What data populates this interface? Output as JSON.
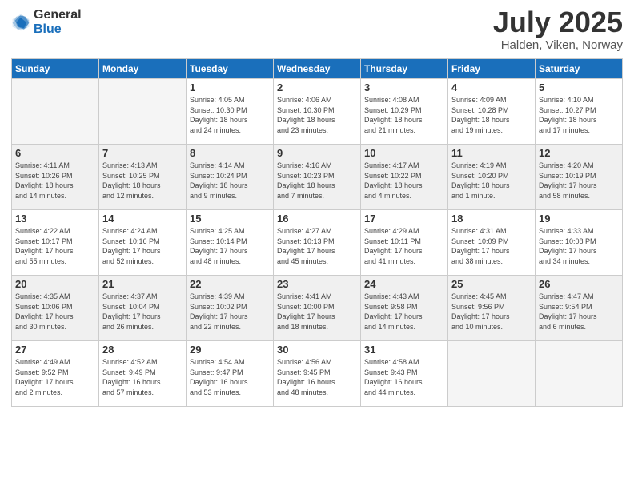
{
  "logo": {
    "general": "General",
    "blue": "Blue"
  },
  "title": {
    "month_year": "July 2025",
    "location": "Halden, Viken, Norway"
  },
  "weekdays": [
    "Sunday",
    "Monday",
    "Tuesday",
    "Wednesday",
    "Thursday",
    "Friday",
    "Saturday"
  ],
  "weeks": [
    [
      {
        "day": "",
        "info": ""
      },
      {
        "day": "",
        "info": ""
      },
      {
        "day": "1",
        "info": "Sunrise: 4:05 AM\nSunset: 10:30 PM\nDaylight: 18 hours\nand 24 minutes."
      },
      {
        "day": "2",
        "info": "Sunrise: 4:06 AM\nSunset: 10:30 PM\nDaylight: 18 hours\nand 23 minutes."
      },
      {
        "day": "3",
        "info": "Sunrise: 4:08 AM\nSunset: 10:29 PM\nDaylight: 18 hours\nand 21 minutes."
      },
      {
        "day": "4",
        "info": "Sunrise: 4:09 AM\nSunset: 10:28 PM\nDaylight: 18 hours\nand 19 minutes."
      },
      {
        "day": "5",
        "info": "Sunrise: 4:10 AM\nSunset: 10:27 PM\nDaylight: 18 hours\nand 17 minutes."
      }
    ],
    [
      {
        "day": "6",
        "info": "Sunrise: 4:11 AM\nSunset: 10:26 PM\nDaylight: 18 hours\nand 14 minutes."
      },
      {
        "day": "7",
        "info": "Sunrise: 4:13 AM\nSunset: 10:25 PM\nDaylight: 18 hours\nand 12 minutes."
      },
      {
        "day": "8",
        "info": "Sunrise: 4:14 AM\nSunset: 10:24 PM\nDaylight: 18 hours\nand 9 minutes."
      },
      {
        "day": "9",
        "info": "Sunrise: 4:16 AM\nSunset: 10:23 PM\nDaylight: 18 hours\nand 7 minutes."
      },
      {
        "day": "10",
        "info": "Sunrise: 4:17 AM\nSunset: 10:22 PM\nDaylight: 18 hours\nand 4 minutes."
      },
      {
        "day": "11",
        "info": "Sunrise: 4:19 AM\nSunset: 10:20 PM\nDaylight: 18 hours\nand 1 minute."
      },
      {
        "day": "12",
        "info": "Sunrise: 4:20 AM\nSunset: 10:19 PM\nDaylight: 17 hours\nand 58 minutes."
      }
    ],
    [
      {
        "day": "13",
        "info": "Sunrise: 4:22 AM\nSunset: 10:17 PM\nDaylight: 17 hours\nand 55 minutes."
      },
      {
        "day": "14",
        "info": "Sunrise: 4:24 AM\nSunset: 10:16 PM\nDaylight: 17 hours\nand 52 minutes."
      },
      {
        "day": "15",
        "info": "Sunrise: 4:25 AM\nSunset: 10:14 PM\nDaylight: 17 hours\nand 48 minutes."
      },
      {
        "day": "16",
        "info": "Sunrise: 4:27 AM\nSunset: 10:13 PM\nDaylight: 17 hours\nand 45 minutes."
      },
      {
        "day": "17",
        "info": "Sunrise: 4:29 AM\nSunset: 10:11 PM\nDaylight: 17 hours\nand 41 minutes."
      },
      {
        "day": "18",
        "info": "Sunrise: 4:31 AM\nSunset: 10:09 PM\nDaylight: 17 hours\nand 38 minutes."
      },
      {
        "day": "19",
        "info": "Sunrise: 4:33 AM\nSunset: 10:08 PM\nDaylight: 17 hours\nand 34 minutes."
      }
    ],
    [
      {
        "day": "20",
        "info": "Sunrise: 4:35 AM\nSunset: 10:06 PM\nDaylight: 17 hours\nand 30 minutes."
      },
      {
        "day": "21",
        "info": "Sunrise: 4:37 AM\nSunset: 10:04 PM\nDaylight: 17 hours\nand 26 minutes."
      },
      {
        "day": "22",
        "info": "Sunrise: 4:39 AM\nSunset: 10:02 PM\nDaylight: 17 hours\nand 22 minutes."
      },
      {
        "day": "23",
        "info": "Sunrise: 4:41 AM\nSunset: 10:00 PM\nDaylight: 17 hours\nand 18 minutes."
      },
      {
        "day": "24",
        "info": "Sunrise: 4:43 AM\nSunset: 9:58 PM\nDaylight: 17 hours\nand 14 minutes."
      },
      {
        "day": "25",
        "info": "Sunrise: 4:45 AM\nSunset: 9:56 PM\nDaylight: 17 hours\nand 10 minutes."
      },
      {
        "day": "26",
        "info": "Sunrise: 4:47 AM\nSunset: 9:54 PM\nDaylight: 17 hours\nand 6 minutes."
      }
    ],
    [
      {
        "day": "27",
        "info": "Sunrise: 4:49 AM\nSunset: 9:52 PM\nDaylight: 17 hours\nand 2 minutes."
      },
      {
        "day": "28",
        "info": "Sunrise: 4:52 AM\nSunset: 9:49 PM\nDaylight: 16 hours\nand 57 minutes."
      },
      {
        "day": "29",
        "info": "Sunrise: 4:54 AM\nSunset: 9:47 PM\nDaylight: 16 hours\nand 53 minutes."
      },
      {
        "day": "30",
        "info": "Sunrise: 4:56 AM\nSunset: 9:45 PM\nDaylight: 16 hours\nand 48 minutes."
      },
      {
        "day": "31",
        "info": "Sunrise: 4:58 AM\nSunset: 9:43 PM\nDaylight: 16 hours\nand 44 minutes."
      },
      {
        "day": "",
        "info": ""
      },
      {
        "day": "",
        "info": ""
      }
    ]
  ]
}
